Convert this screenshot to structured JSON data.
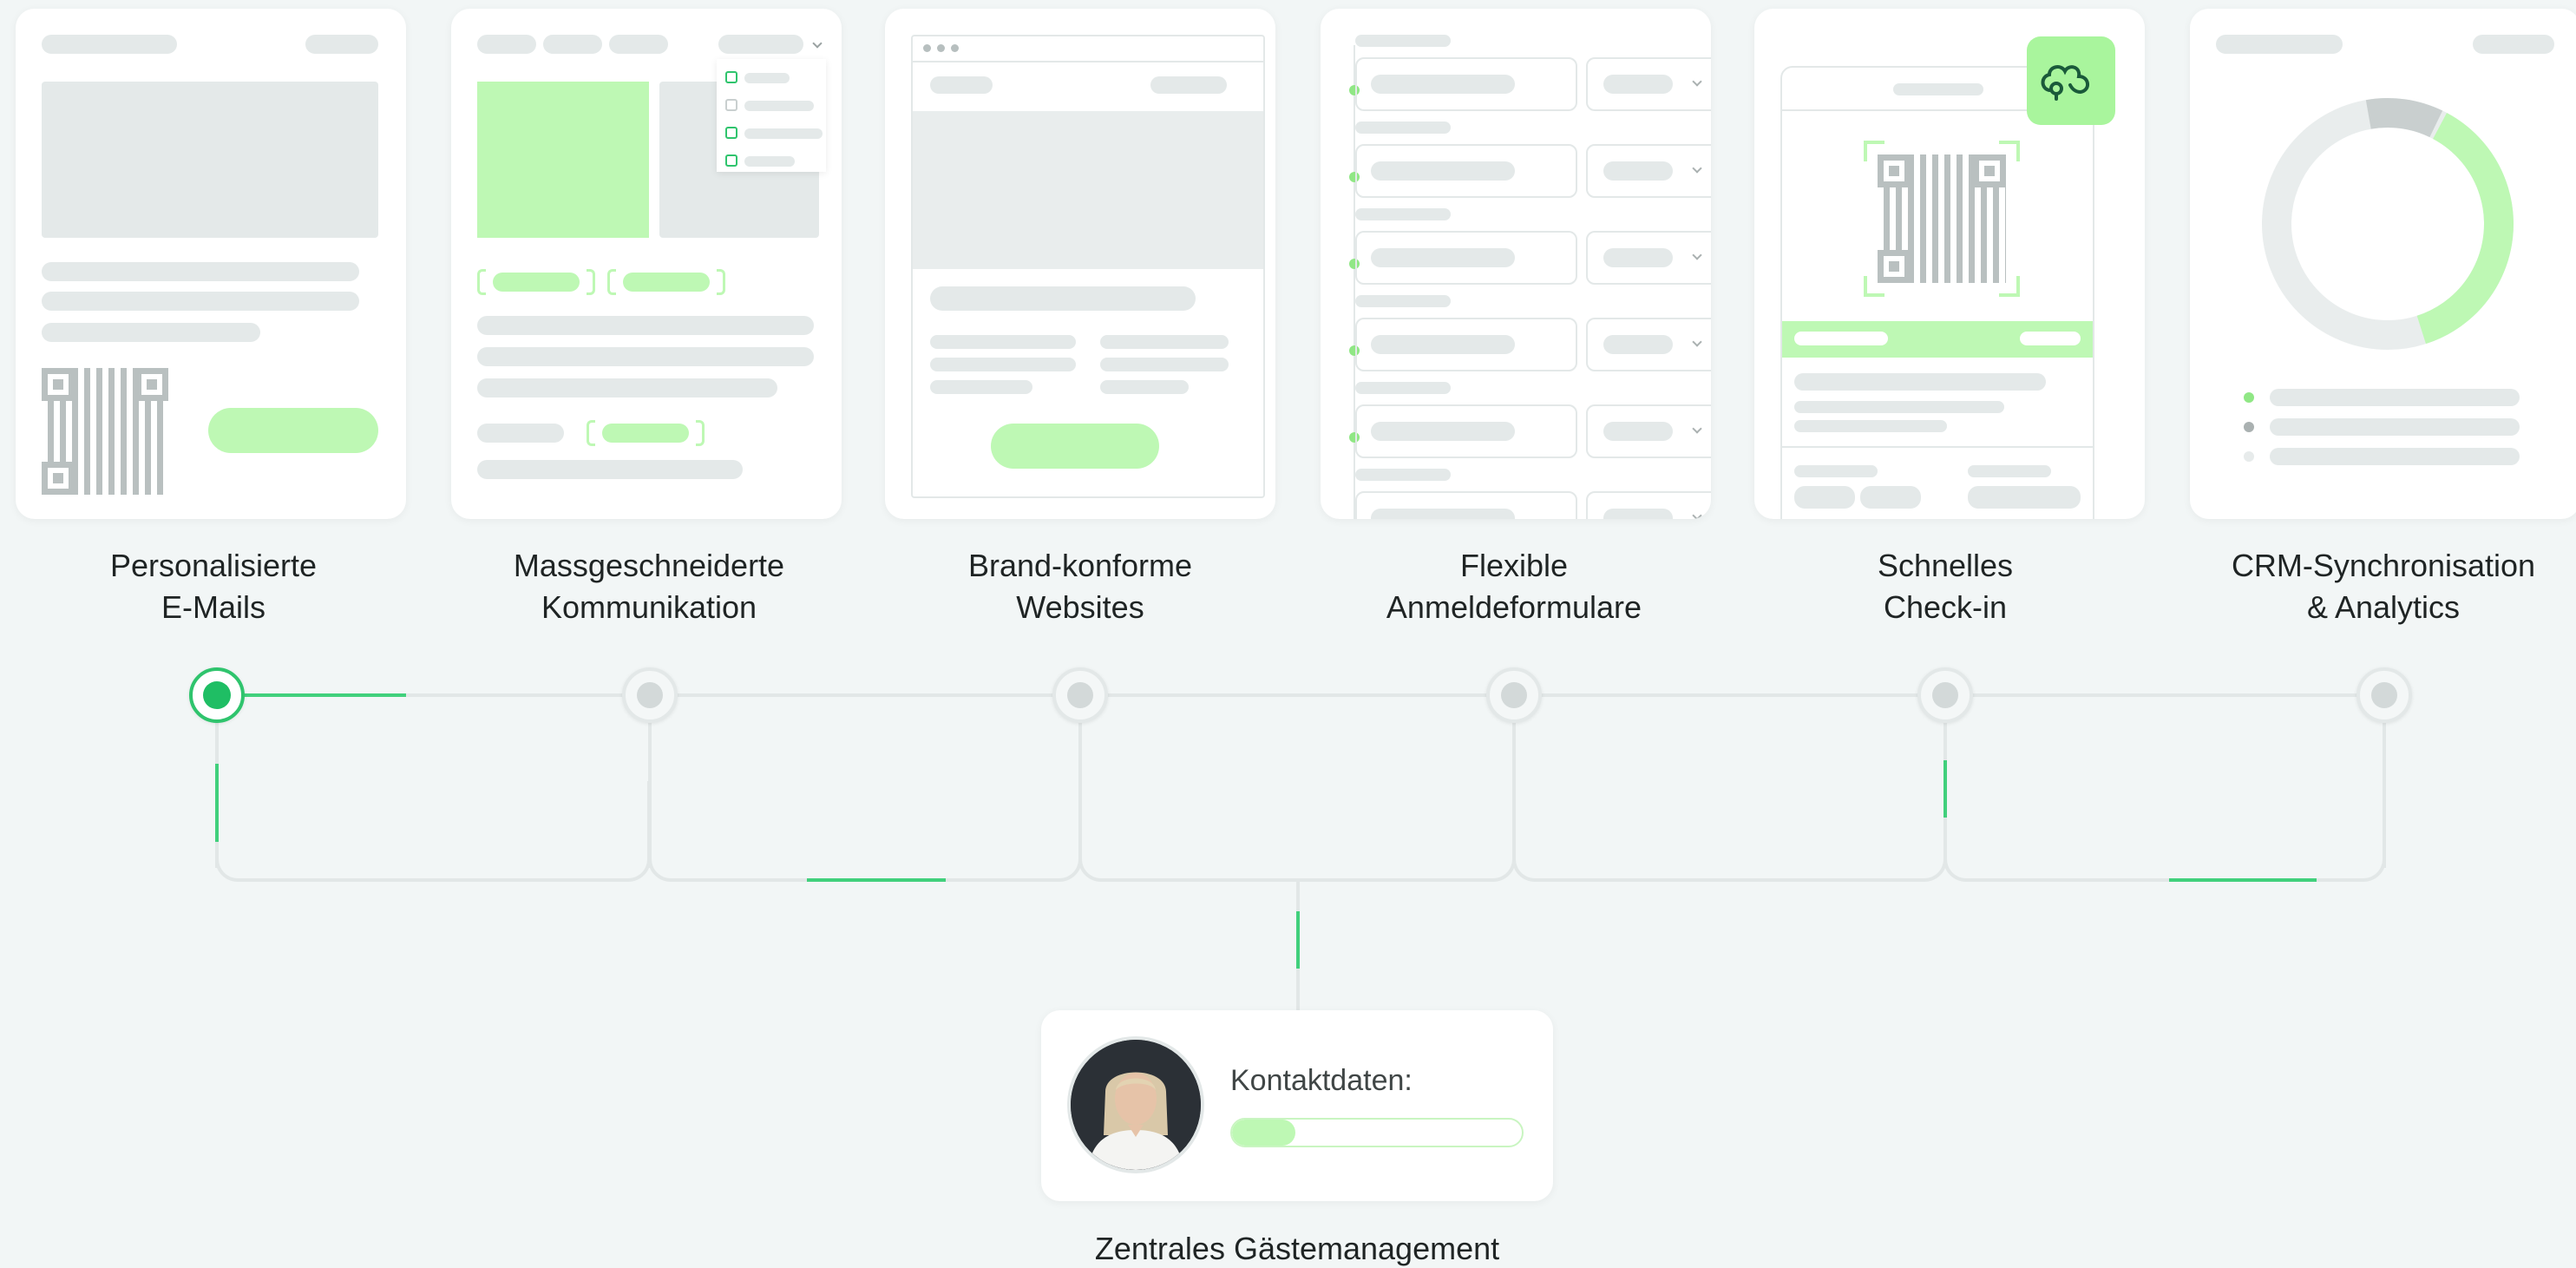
{
  "cards": [
    {
      "label": "Personalisierte\nE-Mails"
    },
    {
      "label": "Massgeschneiderte\nKommunikation"
    },
    {
      "label": "Brand-konforme\nWebsites"
    },
    {
      "label": "Flexible\nAnmeldeformulare"
    },
    {
      "label": "Schnelles\nCheck-in"
    },
    {
      "label": "CRM-Synchronisation\n& Analytics"
    }
  ],
  "timeline": {
    "active_step": 1,
    "steps": 6
  },
  "contact": {
    "label": "Kontaktdaten:",
    "progress_percent": 22
  },
  "bottom_title": "Zentrales Gästemanagement",
  "colors": {
    "accent": "#1fbe64",
    "accent_light": "#bef8b4",
    "placeholder": "#e4e9e9",
    "background": "#f2f6f6"
  },
  "icons": {
    "checkin_badge": "cloud-pin-logo-icon",
    "qr": "qr-code-icon"
  }
}
